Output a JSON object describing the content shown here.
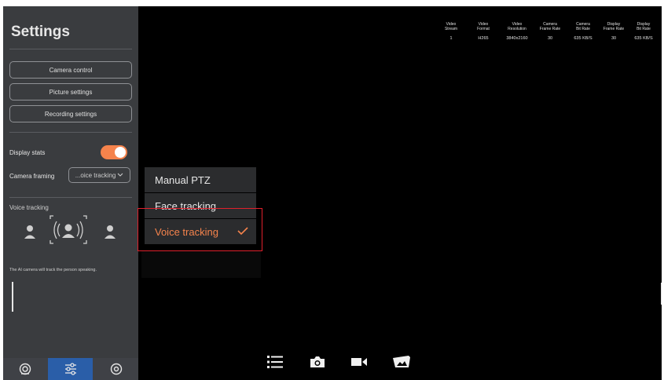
{
  "sidebar": {
    "title": "Settings",
    "buttons": [
      "Camera control",
      "Picture settings",
      "Recording settings"
    ],
    "display_stats_label": "Display stats",
    "display_stats_on": true,
    "camera_framing_label": "Camera framing",
    "camera_framing_value": "...oice tracking",
    "voice_tracking_heading": "Voice tracking",
    "voice_tracking_description": "The AI camera will track the person speaking."
  },
  "framing_menu": {
    "options": [
      "Manual PTZ",
      "Face tracking",
      "Voice tracking"
    ],
    "selected": "Voice tracking"
  },
  "stats": {
    "headers": [
      [
        "Video",
        "Stream"
      ],
      [
        "Video",
        "Format"
      ],
      [
        "Video",
        "Resolution"
      ],
      [
        "Camera",
        "Frame Rate"
      ],
      [
        "Camera",
        "Bit Rate"
      ],
      [
        "Display",
        "Frame Rate"
      ],
      [
        "Display",
        "Bit Rate"
      ]
    ],
    "values": [
      "1",
      "H265",
      "3840x2160",
      "30",
      "635 KB/S",
      "30",
      "635 KB/S"
    ]
  },
  "bottom_tabs": [
    {
      "icon": "camera-lens-icon",
      "active": false
    },
    {
      "icon": "sliders-icon",
      "active": true
    },
    {
      "icon": "target-icon",
      "active": false
    }
  ],
  "toolbar": [
    "list-icon",
    "camera-icon",
    "video-icon",
    "gallery-icon"
  ],
  "colors": {
    "accent": "#f5834c",
    "sidebar_bg": "#3a3c3f",
    "highlight_box": "#e0202c",
    "active_tab": "#2a5ea8"
  }
}
